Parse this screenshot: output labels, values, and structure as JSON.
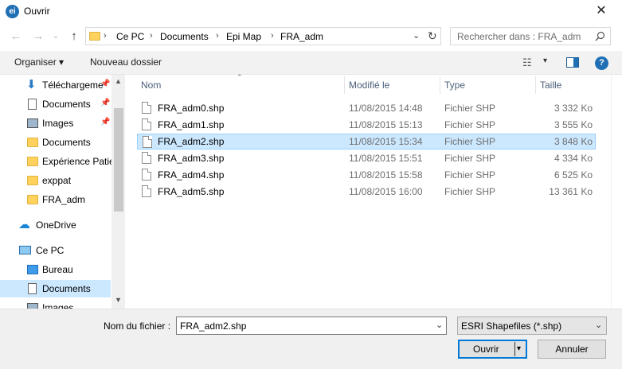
{
  "window": {
    "title": "Ouvrir",
    "app_icon_text": "ei",
    "close_glyph": "✕"
  },
  "address": {
    "crumbs": [
      "Ce PC",
      "Documents",
      "Epi Map",
      "FRA_adm"
    ],
    "separator": "›",
    "search_placeholder": "Rechercher dans : FRA_adm"
  },
  "toolbar": {
    "organize_label": "Organiser ▾",
    "new_folder_label": "Nouveau dossier"
  },
  "sidebar": {
    "items": [
      {
        "label": "Téléchargeme",
        "icon": "download-arrow-icon",
        "pinned": true
      },
      {
        "label": "Documents",
        "icon": "document-icon",
        "pinned": true
      },
      {
        "label": "Images",
        "icon": "image-icon",
        "pinned": true
      },
      {
        "label": "Documents",
        "icon": "folder-icon",
        "pinned": false
      },
      {
        "label": "Expérience Patie",
        "icon": "folder-icon",
        "pinned": false
      },
      {
        "label": "exppat",
        "icon": "folder-icon",
        "pinned": false
      },
      {
        "label": "FRA_adm",
        "icon": "folder-icon",
        "pinned": false
      },
      {
        "label": "OneDrive",
        "icon": "cloud-icon",
        "pinned": false
      },
      {
        "label": "Ce PC",
        "icon": "computer-icon",
        "pinned": false
      },
      {
        "label": "Bureau",
        "icon": "desktop-icon",
        "pinned": false
      },
      {
        "label": "Documents",
        "icon": "document-icon",
        "pinned": false,
        "selected": true
      },
      {
        "label": "Images",
        "icon": "image-icon",
        "pinned": false
      }
    ]
  },
  "columns": {
    "name": "Nom",
    "modified": "Modifié le",
    "type": "Type",
    "size": "Taille"
  },
  "files": [
    {
      "name": "FRA_adm0.shp",
      "modified": "11/08/2015 14:48",
      "type": "Fichier SHP",
      "size": "3 332 Ko"
    },
    {
      "name": "FRA_adm1.shp",
      "modified": "11/08/2015 15:13",
      "type": "Fichier SHP",
      "size": "3 555 Ko"
    },
    {
      "name": "FRA_adm2.shp",
      "modified": "11/08/2015 15:34",
      "type": "Fichier SHP",
      "size": "3 848 Ko",
      "selected": true
    },
    {
      "name": "FRA_adm3.shp",
      "modified": "11/08/2015 15:51",
      "type": "Fichier SHP",
      "size": "4 334 Ko"
    },
    {
      "name": "FRA_adm4.shp",
      "modified": "11/08/2015 15:58",
      "type": "Fichier SHP",
      "size": "6 525 Ko"
    },
    {
      "name": "FRA_adm5.shp",
      "modified": "11/08/2015 16:00",
      "type": "Fichier SHP",
      "size": "13 361 Ko"
    }
  ],
  "footer": {
    "filename_label": "Nom du fichier :",
    "filename_value": "FRA_adm2.shp",
    "filter_value": "ESRI Shapefiles (*.shp)",
    "open_label": "Ouvrir",
    "cancel_label": "Annuler"
  },
  "colors": {
    "accent": "#0078d7",
    "selection": "#cce8ff"
  }
}
